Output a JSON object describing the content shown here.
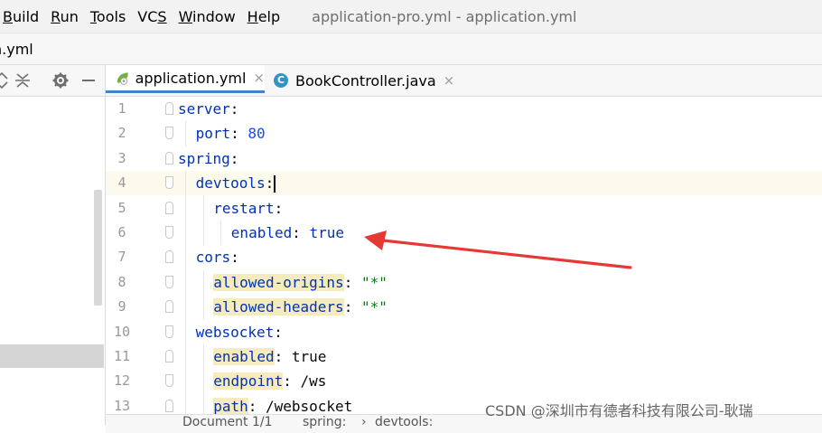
{
  "menu": {
    "items": [
      {
        "label": "Build",
        "mnemonic": "B",
        "rest": "uild"
      },
      {
        "label": "Run",
        "mnemonic": "R",
        "rest": "un"
      },
      {
        "label": "Tools",
        "mnemonic": "T",
        "rest": "ools"
      },
      {
        "label": "VCS",
        "mnemonic": "S",
        "pre": "VC",
        "rest": ""
      },
      {
        "label": "Window",
        "mnemonic": "W",
        "rest": "indow"
      },
      {
        "label": "Help",
        "mnemonic": "H",
        "rest": "elp"
      }
    ],
    "window_title": "application-pro.yml - application.yml"
  },
  "navbar": {
    "file": "n.yml"
  },
  "tabs": [
    {
      "label": "application.yml",
      "icon": "yaml-file-icon",
      "active": true
    },
    {
      "label": "BookController.java",
      "icon": "java-class-icon",
      "active": false
    }
  ],
  "tab_close_glyph": "×",
  "class_icon_letter": "C",
  "editor": {
    "lines": [
      {
        "n": "1",
        "indent": 0,
        "parts": [
          {
            "t": "server",
            "c": "key"
          },
          {
            "t": ":",
            "c": "plain"
          }
        ]
      },
      {
        "n": "2",
        "indent": 1,
        "parts": [
          {
            "t": "port",
            "c": "key"
          },
          {
            "t": ": ",
            "c": "plain"
          },
          {
            "t": "80",
            "c": "num"
          }
        ]
      },
      {
        "n": "3",
        "indent": 0,
        "parts": [
          {
            "t": "spring",
            "c": "key"
          },
          {
            "t": ":",
            "c": "plain"
          }
        ]
      },
      {
        "n": "4",
        "indent": 1,
        "current": true,
        "parts": [
          {
            "t": "devtools",
            "c": "key"
          },
          {
            "t": ":",
            "c": "plain"
          }
        ]
      },
      {
        "n": "5",
        "indent": 2,
        "parts": [
          {
            "t": "restart",
            "c": "key"
          },
          {
            "t": ":",
            "c": "plain"
          }
        ]
      },
      {
        "n": "6",
        "indent": 3,
        "parts": [
          {
            "t": "enabled",
            "c": "key"
          },
          {
            "t": ": ",
            "c": "plain"
          },
          {
            "t": "true",
            "c": "key"
          }
        ]
      },
      {
        "n": "7",
        "indent": 1,
        "parts": [
          {
            "t": "cors",
            "c": "key"
          },
          {
            "t": ":",
            "c": "plain"
          }
        ]
      },
      {
        "n": "8",
        "indent": 2,
        "parts": [
          {
            "t": "allowed-origins",
            "c": "key hl"
          },
          {
            "t": ": ",
            "c": "plain"
          },
          {
            "t": "\"*\"",
            "c": "str"
          }
        ]
      },
      {
        "n": "9",
        "indent": 2,
        "parts": [
          {
            "t": "allowed-headers",
            "c": "key hl"
          },
          {
            "t": ": ",
            "c": "plain"
          },
          {
            "t": "\"*\"",
            "c": "str"
          }
        ]
      },
      {
        "n": "10",
        "indent": 1,
        "parts": [
          {
            "t": "websocket",
            "c": "key"
          },
          {
            "t": ":",
            "c": "plain"
          }
        ]
      },
      {
        "n": "11",
        "indent": 2,
        "parts": [
          {
            "t": "enabled",
            "c": "key hl"
          },
          {
            "t": ": ",
            "c": "plain"
          },
          {
            "t": "true",
            "c": "plain"
          }
        ]
      },
      {
        "n": "12",
        "indent": 2,
        "parts": [
          {
            "t": "endpoint",
            "c": "key hl"
          },
          {
            "t": ": ",
            "c": "plain"
          },
          {
            "t": "/ws",
            "c": "plain"
          }
        ]
      },
      {
        "n": "13",
        "indent": 2,
        "parts": [
          {
            "t": "path",
            "c": "key hl"
          },
          {
            "t": ": ",
            "c": "plain"
          },
          {
            "t": "/websocket",
            "c": "plain"
          }
        ]
      }
    ]
  },
  "breadcrumb": {
    "doc": "Document 1/1",
    "items": [
      "spring:",
      "devtools:"
    ],
    "separator": "›"
  },
  "watermark": "CSDN @深圳市有德者科技有限公司-耿瑞",
  "colors": {
    "accent": "#4083c9",
    "arrow": "#e53935",
    "key": "#0033b3",
    "string": "#067d17",
    "number": "#1750eb"
  }
}
